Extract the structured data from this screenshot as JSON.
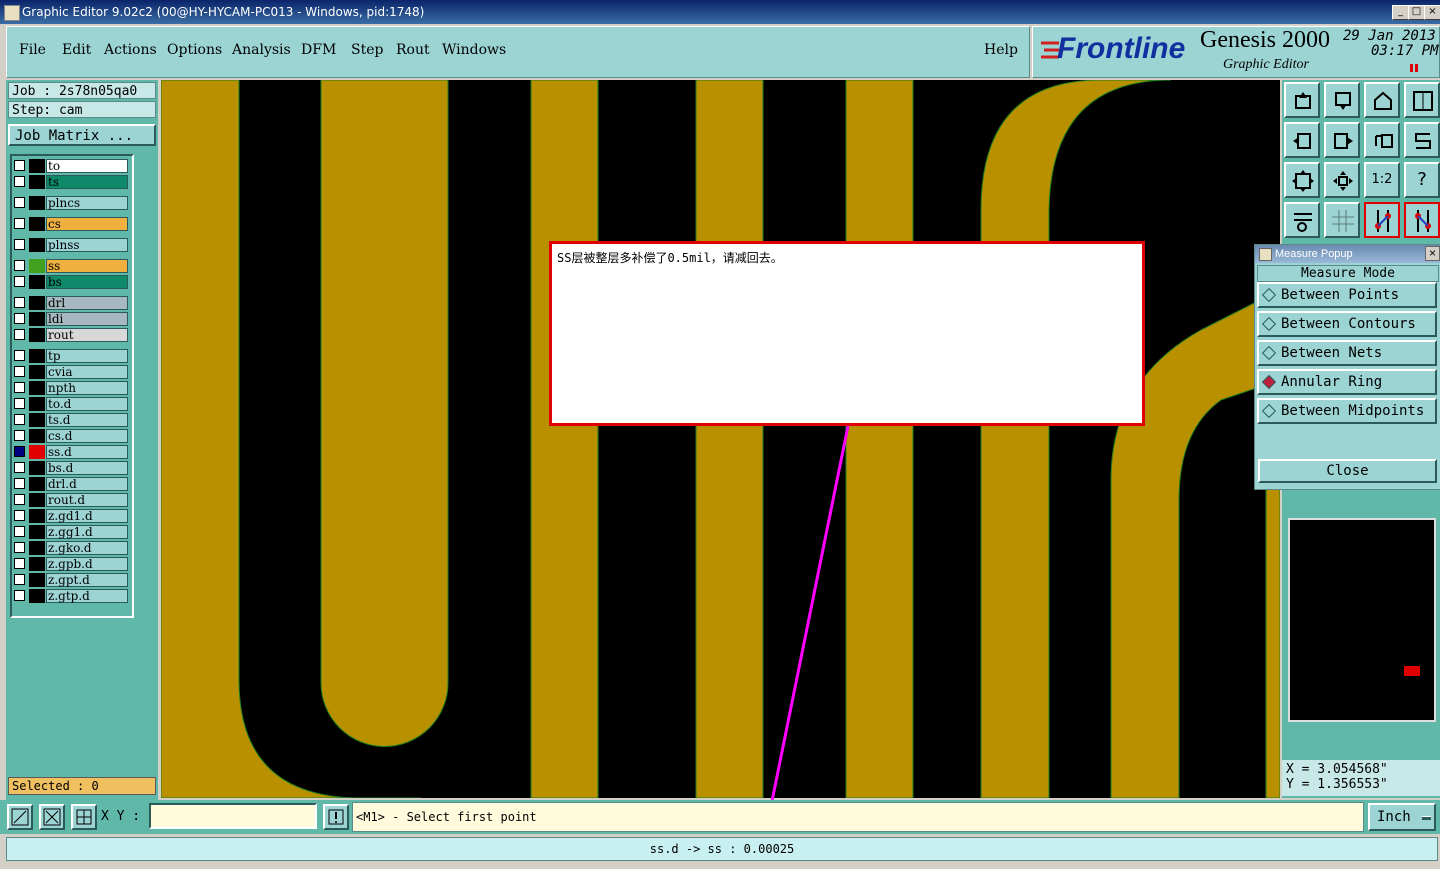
{
  "window": {
    "title": "Graphic Editor 9.02c2 (00@HY-HYCAM-PC013 - Windows, pid:1748)"
  },
  "menu": {
    "items": [
      "File",
      "Edit",
      "Actions",
      "Options",
      "Analysis",
      "DFM",
      "Step",
      "Rout",
      "Windows"
    ],
    "help": "Help"
  },
  "brand": {
    "logo": "Frontline",
    "product": "Genesis 2000",
    "subtitle": "Graphic Editor",
    "date": "29 Jan 2013",
    "time": "03:17 PM"
  },
  "job": {
    "job_line": "Job : 2s78n05qa0",
    "step_line": "Step: cam",
    "matrix_button": "Job Matrix ..."
  },
  "layers": [
    "to",
    "ts",
    "plncs",
    "cs",
    "plnss",
    "ss",
    "bs",
    "drl",
    "ldi",
    "rout",
    "tp",
    "cvia",
    "npth",
    "to.d",
    "ts.d",
    "cs.d",
    "ss.d",
    "bs.d",
    "drl.d",
    "rout.d",
    "z.gd1.d",
    "z.gg1.d",
    "z.gko.d",
    "z.gpb.d",
    "z.gpt.d",
    "z.gtp.d"
  ],
  "selected": "Selected : 0",
  "note": "SS层被整层多补偿了0.5mil，请减回去。",
  "measure": {
    "title": "Measure Popup",
    "mode_label": "Measure Mode",
    "options": [
      "Between Points",
      "Between Contours",
      "Between Nets",
      "Annular Ring",
      "Between Midpoints"
    ],
    "active": "Annular Ring",
    "close": "Close"
  },
  "coords": {
    "x": "X = 3.054568\"",
    "y": "Y = 1.356553\""
  },
  "bottom": {
    "xy_label": "X Y :",
    "xy_value": "",
    "prompt": "<M1> - Select first point",
    "unit": "Inch"
  },
  "status": "ss.d -> ss : 0.00025",
  "toolbar": {
    "one_to_two": "1:2",
    "help_glyph": "?"
  },
  "colors": {
    "copper": "#b89000",
    "panel": "#5fb8a8",
    "menubar": "#9cd4d4",
    "annotation_border": "#e00000",
    "arrow": "#ff00ff"
  }
}
